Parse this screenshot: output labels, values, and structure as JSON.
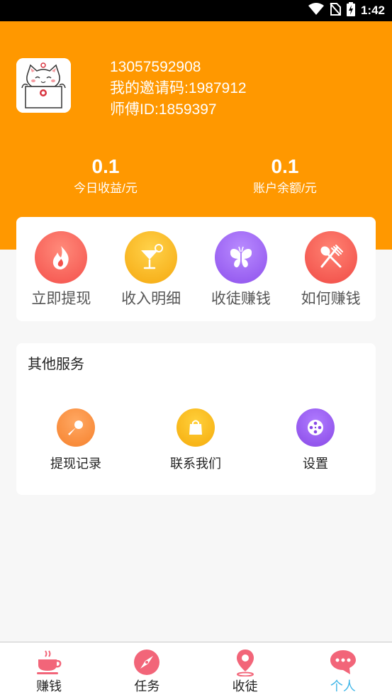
{
  "status_bar": {
    "time": "1:42"
  },
  "profile": {
    "phone": "13057592908",
    "invite_code": "我的邀请码:1987912",
    "master_id": "师傅ID:1859397"
  },
  "stats": {
    "today": {
      "value": "0.1",
      "label": "今日收益/元"
    },
    "balance": {
      "value": "0.1",
      "label": "账户余额/元"
    }
  },
  "quick_actions": [
    {
      "label": "立即提现",
      "icon": "flame-icon",
      "color": "#f65f5a"
    },
    {
      "label": "收入明细",
      "icon": "cocktail-icon",
      "color": "#f8b51b"
    },
    {
      "label": "收徒赚钱",
      "icon": "butterfly-icon",
      "color": "#9b62f0"
    },
    {
      "label": "如何赚钱",
      "icon": "fork-spoon-icon",
      "color": "#f6584f"
    }
  ],
  "services": {
    "title": "其他服务",
    "items": [
      {
        "label": "提现记录",
        "icon": "microphone-icon",
        "color": "#f98c3c"
      },
      {
        "label": "联系我们",
        "icon": "shopping-bag-icon",
        "color": "#f7b514"
      },
      {
        "label": "设置",
        "icon": "film-reel-icon",
        "color": "#9a5cea"
      }
    ]
  },
  "tab_bar": {
    "tabs": [
      {
        "label": "赚钱",
        "icon": "coffee-cup-icon",
        "active": false
      },
      {
        "label": "任务",
        "icon": "compass-icon",
        "active": false
      },
      {
        "label": "收徒",
        "icon": "map-pin-icon",
        "active": false
      },
      {
        "label": "个人",
        "icon": "chat-bubble-icon",
        "active": true
      }
    ],
    "icon_color": "#f26579",
    "active_color": "#3fb6e8"
  }
}
